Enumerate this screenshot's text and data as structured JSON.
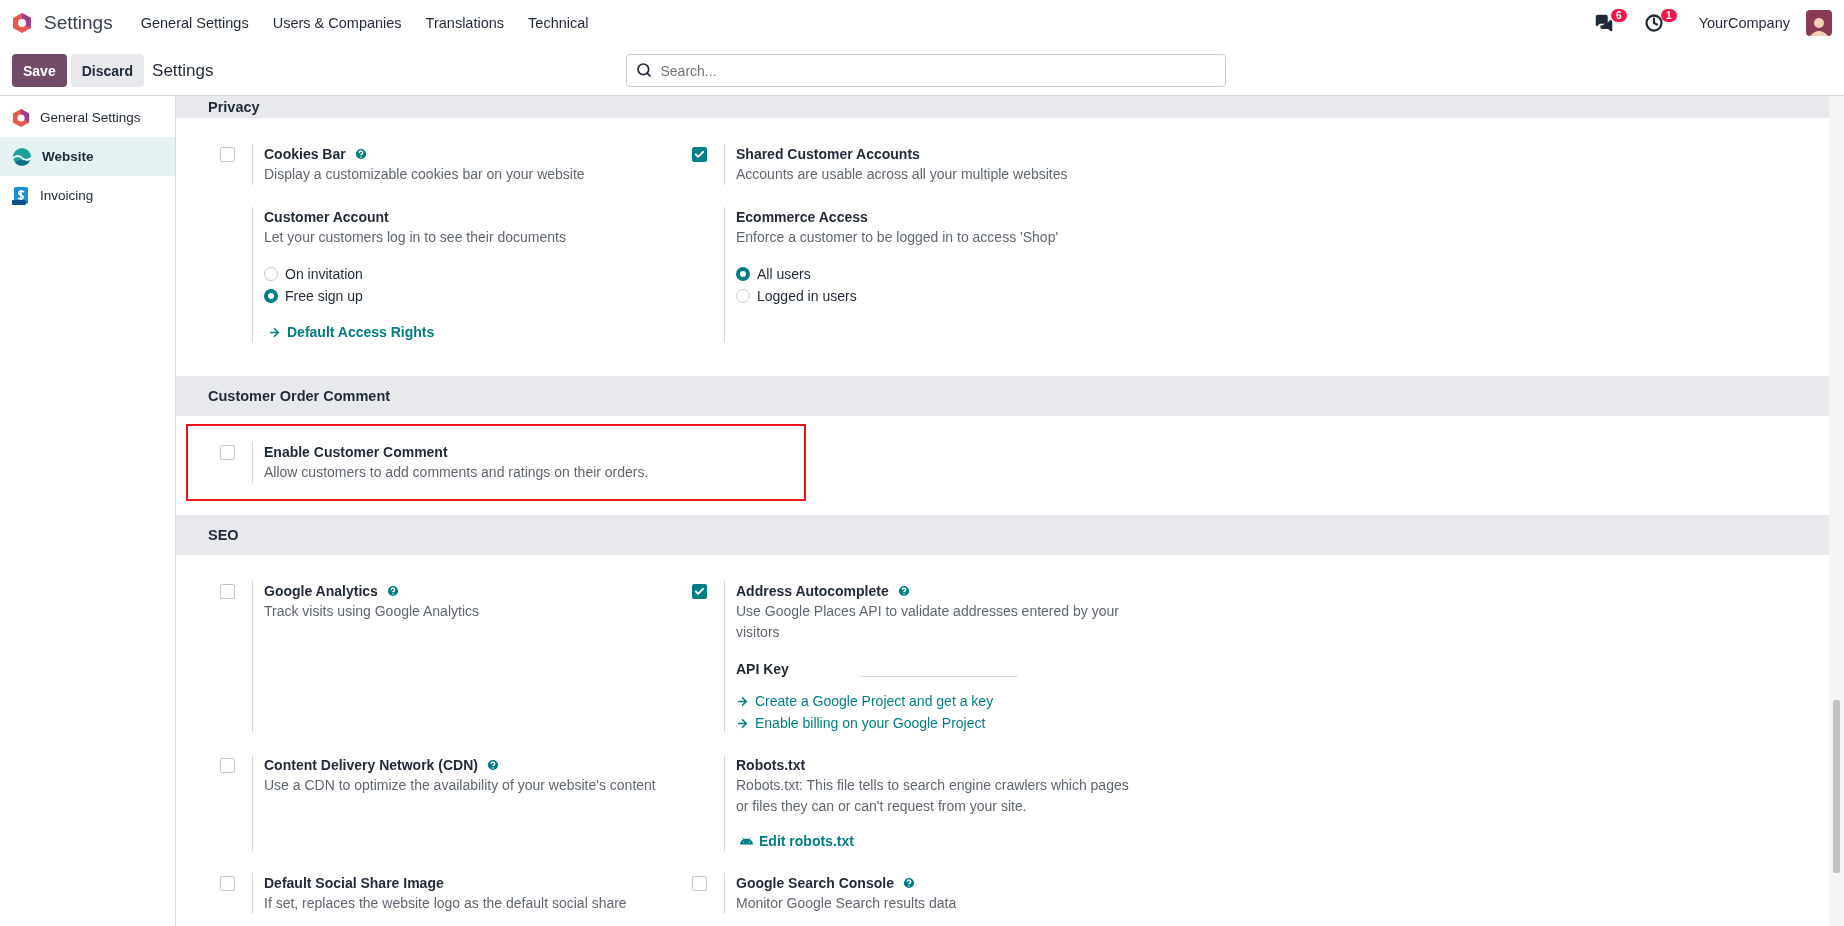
{
  "navbar": {
    "app_title": "Settings",
    "menu": [
      "General Settings",
      "Users & Companies",
      "Translations",
      "Technical"
    ],
    "messages_badge": "6",
    "activities_badge": "1",
    "company": "YourCompany"
  },
  "control_panel": {
    "save": "Save",
    "discard": "Discard",
    "breadcrumb": "Settings",
    "search": {
      "placeholder": "Search..."
    }
  },
  "sidebar": {
    "items": [
      {
        "label": "General Settings",
        "kind": "general",
        "selected": false
      },
      {
        "label": "Website",
        "kind": "website",
        "selected": true
      },
      {
        "label": "Invoicing",
        "kind": "invoicing",
        "selected": false
      }
    ]
  },
  "sections": [
    {
      "title": "Privacy",
      "settings": [
        {
          "kind": "checkbox",
          "checked": false,
          "title": "Cookies Bar",
          "help": true,
          "highlighted": false,
          "description": "Display a customizable cookies bar on your website"
        },
        {
          "kind": "checkbox",
          "checked": true,
          "title": "Shared Customer Accounts",
          "help": false,
          "highlighted": false,
          "description": "Accounts are usable across all your multiple websites"
        },
        {
          "kind": "plain",
          "title": "Customer Account",
          "help": false,
          "highlighted": false,
          "description": "Let your customers log in to see their documents",
          "options": [
            {
              "label": "On invitation",
              "selected": false
            },
            {
              "label": "Free sign up",
              "selected": true
            }
          ],
          "links": [
            {
              "label": "Default Access Rights",
              "kind": "arrow-button"
            }
          ]
        },
        {
          "kind": "plain",
          "title": "Ecommerce Access",
          "help": false,
          "highlighted": false,
          "description": "Enforce a customer to be logged in to access 'Shop'",
          "options": [
            {
              "label": "All users",
              "selected": true
            },
            {
              "label": "Logged in users",
              "selected": false
            }
          ]
        }
      ]
    },
    {
      "title": "Customer Order Comment",
      "settings": [
        {
          "kind": "checkbox",
          "checked": false,
          "title": "Enable Customer Comment",
          "help": false,
          "highlighted": true,
          "description": "Allow customers to add comments and ratings on their orders."
        }
      ]
    },
    {
      "title": "SEO",
      "settings": [
        {
          "kind": "checkbox",
          "checked": false,
          "title": "Google Analytics",
          "help": true,
          "highlighted": false,
          "description": "Track visits using Google Analytics"
        },
        {
          "kind": "checkbox",
          "checked": true,
          "title": "Address Autocomplete",
          "help": true,
          "highlighted": false,
          "description": "Use Google Places API to validate addresses entered by your visitors",
          "field": {
            "label": "API Key"
          },
          "links": [
            {
              "label": "Create a Google Project and get a key",
              "kind": "arrow"
            },
            {
              "label": "Enable billing on your Google Project",
              "kind": "arrow"
            }
          ]
        },
        {
          "kind": "checkbox",
          "checked": false,
          "title": "Content Delivery Network (CDN)",
          "help": true,
          "highlighted": false,
          "description": "Use a CDN to optimize the availability of your website's content"
        },
        {
          "kind": "plain",
          "title": "Robots.txt",
          "help": false,
          "highlighted": false,
          "description": "Robots.txt: This file tells to search engine crawlers which pages or files they can or can't request from your site.",
          "links": [
            {
              "label": "Edit robots.txt",
              "kind": "robot-button"
            }
          ]
        },
        {
          "kind": "checkbox",
          "checked": false,
          "title": "Default Social Share Image",
          "help": false,
          "highlighted": false,
          "description": "If set, replaces the website logo as the default social share"
        },
        {
          "kind": "checkbox",
          "checked": false,
          "title": "Google Search Console",
          "help": true,
          "highlighted": false,
          "description": "Monitor Google Search results data"
        }
      ]
    }
  ]
}
